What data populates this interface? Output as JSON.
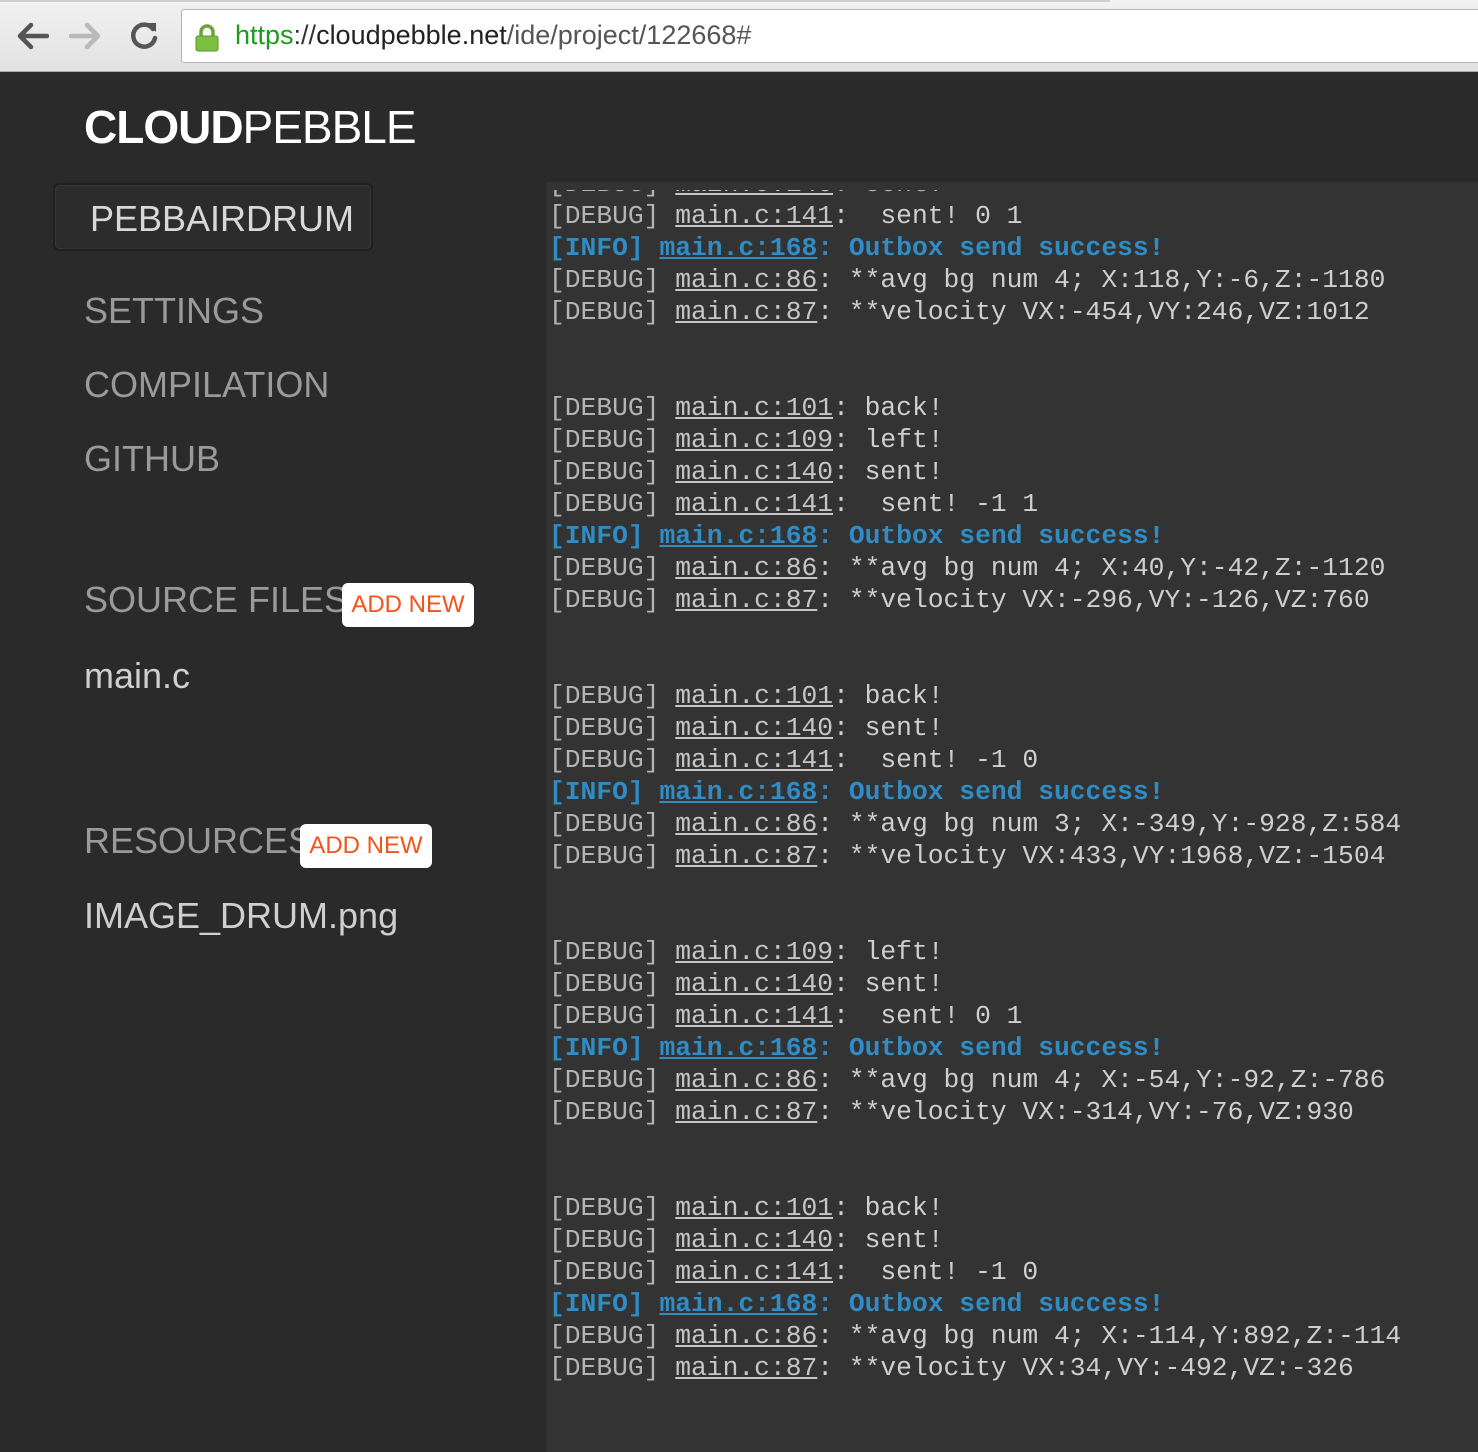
{
  "browser": {
    "url_scheme": "https",
    "url_sep": "://",
    "url_host": "cloudpebble.net",
    "url_path": "/ide/project/122668#"
  },
  "logo": {
    "bold": "CLOUD",
    "light": "PEBBLE"
  },
  "sidebar": {
    "project_name": "PEBBAIRDRUM",
    "nav": [
      "SETTINGS",
      "COMPILATION",
      "GITHUB"
    ],
    "source_files": {
      "title": "SOURCE FILES",
      "add_label": "ADD NEW",
      "files": [
        "main.c"
      ]
    },
    "resources": {
      "title": "RESOURCES",
      "add_label": "ADD NEW",
      "files": [
        "IMAGE_DRUM.png"
      ]
    }
  },
  "colors": {
    "accent_orange": "#f2541b",
    "info_blue": "#2f8cc4",
    "secure_green": "#1e9a1e"
  },
  "console": {
    "lines": [
      {
        "level": "[DEBUG]",
        "loc": "main.c:141",
        "msg": ":  sent! 0 1"
      },
      {
        "level": "[INFO]",
        "loc": "main.c:168",
        "msg": ": Outbox send success!"
      },
      {
        "level": "[DEBUG]",
        "loc": "main.c:86",
        "msg": ": **avg bg num 4; X:118,Y:-6,Z:-1180"
      },
      {
        "level": "[DEBUG]",
        "loc": "main.c:87",
        "msg": ": **velocity VX:-454,VY:246,VZ:1012"
      },
      {
        "gap": true
      },
      {
        "level": "[DEBUG]",
        "loc": "main.c:101",
        "msg": ": back!"
      },
      {
        "level": "[DEBUG]",
        "loc": "main.c:109",
        "msg": ": left!"
      },
      {
        "level": "[DEBUG]",
        "loc": "main.c:140",
        "msg": ": sent!"
      },
      {
        "level": "[DEBUG]",
        "loc": "main.c:141",
        "msg": ":  sent! -1 1"
      },
      {
        "level": "[INFO]",
        "loc": "main.c:168",
        "msg": ": Outbox send success!"
      },
      {
        "level": "[DEBUG]",
        "loc": "main.c:86",
        "msg": ": **avg bg num 4; X:40,Y:-42,Z:-1120"
      },
      {
        "level": "[DEBUG]",
        "loc": "main.c:87",
        "msg": ": **velocity VX:-296,VY:-126,VZ:760"
      },
      {
        "gap": true
      },
      {
        "level": "[DEBUG]",
        "loc": "main.c:101",
        "msg": ": back!"
      },
      {
        "level": "[DEBUG]",
        "loc": "main.c:140",
        "msg": ": sent!"
      },
      {
        "level": "[DEBUG]",
        "loc": "main.c:141",
        "msg": ":  sent! -1 0"
      },
      {
        "level": "[INFO]",
        "loc": "main.c:168",
        "msg": ": Outbox send success!"
      },
      {
        "level": "[DEBUG]",
        "loc": "main.c:86",
        "msg": ": **avg bg num 3; X:-349,Y:-928,Z:584"
      },
      {
        "level": "[DEBUG]",
        "loc": "main.c:87",
        "msg": ": **velocity VX:433,VY:1968,VZ:-1504"
      },
      {
        "gap": true
      },
      {
        "level": "[DEBUG]",
        "loc": "main.c:109",
        "msg": ": left!"
      },
      {
        "level": "[DEBUG]",
        "loc": "main.c:140",
        "msg": ": sent!"
      },
      {
        "level": "[DEBUG]",
        "loc": "main.c:141",
        "msg": ":  sent! 0 1"
      },
      {
        "level": "[INFO]",
        "loc": "main.c:168",
        "msg": ": Outbox send success!"
      },
      {
        "level": "[DEBUG]",
        "loc": "main.c:86",
        "msg": ": **avg bg num 4; X:-54,Y:-92,Z:-786"
      },
      {
        "level": "[DEBUG]",
        "loc": "main.c:87",
        "msg": ": **velocity VX:-314,VY:-76,VZ:930"
      },
      {
        "gap": true
      },
      {
        "level": "[DEBUG]",
        "loc": "main.c:101",
        "msg": ": back!"
      },
      {
        "level": "[DEBUG]",
        "loc": "main.c:140",
        "msg": ": sent!"
      },
      {
        "level": "[DEBUG]",
        "loc": "main.c:141",
        "msg": ":  sent! -1 0"
      },
      {
        "level": "[INFO]",
        "loc": "main.c:168",
        "msg": ": Outbox send success!"
      },
      {
        "level": "[DEBUG]",
        "loc": "main.c:86",
        "msg": ": **avg bg num 4; X:-114,Y:892,Z:-114"
      },
      {
        "level": "[DEBUG]",
        "loc": "main.c:87",
        "msg": ": **velocity VX:34,VY:-492,VZ:-326"
      }
    ]
  }
}
